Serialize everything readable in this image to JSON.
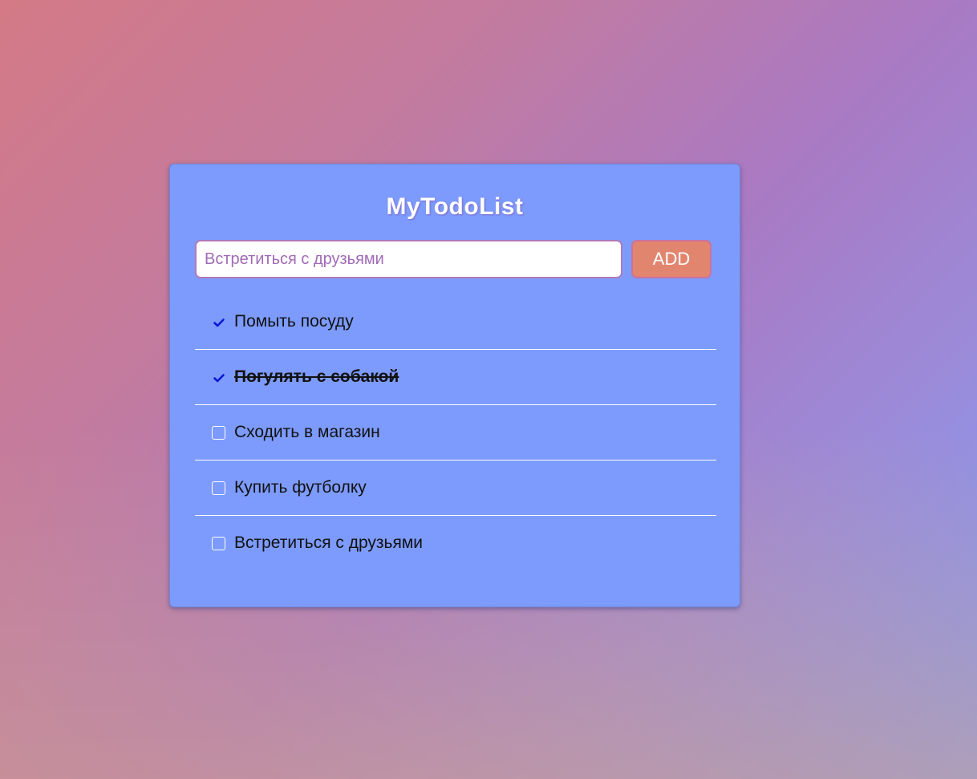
{
  "app": {
    "title": "MyTodoList"
  },
  "form": {
    "input_value": "",
    "input_placeholder": "Встретиться с друзьями",
    "add_label": "ADD"
  },
  "tasks": [
    {
      "text": "Помыть посуду",
      "state": "checked",
      "strike": false,
      "icon": "checkmark-icon"
    },
    {
      "text": "Погулять с собакой",
      "state": "checked",
      "strike": true,
      "icon": "checkmark-icon"
    },
    {
      "text": "Сходить в магазин",
      "state": "unchecked",
      "strike": false,
      "icon": "checkbox-icon"
    },
    {
      "text": "Купить футболку",
      "state": "unchecked",
      "strike": false,
      "icon": "checkbox-icon"
    },
    {
      "text": "Встретиться с друзьями",
      "state": "unchecked",
      "strike": false,
      "icon": "checkbox-icon"
    }
  ],
  "colors": {
    "card_background": "#7d9bfd",
    "button_background": "#e1856f",
    "checkmark": "#0a1ad6",
    "placeholder": "#a16bb7"
  }
}
